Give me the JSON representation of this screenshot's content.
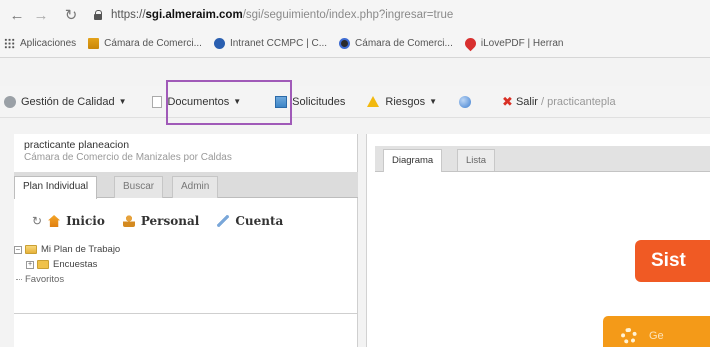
{
  "browser": {
    "url_prefix": "https://",
    "url_domain": "sgi.almeraim.com",
    "url_path": "/sgi/seguimiento/index.php?ingresar=true"
  },
  "bookmarks": [
    {
      "label": "Aplicaciones",
      "icon": "apps-icon"
    },
    {
      "label": "Cámara de Comerci...",
      "icon": "bank-icon"
    },
    {
      "label": "Intranet CCMPC | C...",
      "icon": "ccmpc-icon"
    },
    {
      "label": "Cámara de Comerci...",
      "icon": "camara-icon"
    },
    {
      "label": "iLovePDF | Herran",
      "icon": "pdf-icon"
    }
  ],
  "toolbar": {
    "gestion_label": "Gestión de Calidad",
    "documentos_label": "Documentos",
    "solicitudes_label": "Solicitudes",
    "riesgos_label": "Riesgos",
    "salir_label": "Salir",
    "salir_user": "/ practicantepla"
  },
  "user": {
    "name": "practicante planeacion",
    "org": "Cámara de Comercio de Manizales por Caldas"
  },
  "left_tabs": [
    "Plan Individual",
    "Buscar",
    "Admin"
  ],
  "subnav": {
    "inicio": "Inicio",
    "personal": "Personal",
    "cuenta": "Cuenta"
  },
  "tree": {
    "mi_plan": "Mi Plan de Trabajo",
    "encuestas": "Encuestas",
    "favoritos": "Favoritos"
  },
  "right_tabs": [
    "Diagrama",
    "Lista"
  ],
  "right_content": {
    "banner_text": "Sist",
    "button_text": "Ge"
  },
  "colors": {
    "highlight": "#a05ab8",
    "banner": "#f05a24",
    "button": "#f49a18"
  }
}
